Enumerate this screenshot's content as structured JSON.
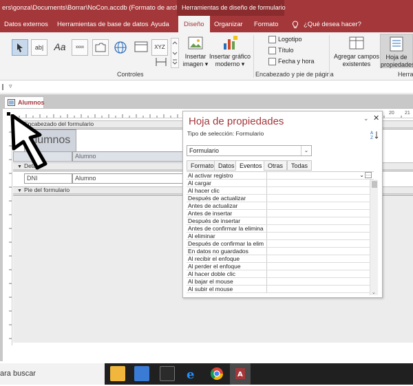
{
  "titlebar": {
    "title": "ers\\gonza\\Documents\\Borrar\\NoCon.accdb (Formato de archi...",
    "context_title": "Herramientas de diseño de formulario"
  },
  "tabs": [
    {
      "label": "Datos externos"
    },
    {
      "label": "Herramientas de base de datos"
    },
    {
      "label": "Ayuda"
    },
    {
      "label": "Diseño"
    },
    {
      "label": "Organizar"
    },
    {
      "label": "Formato"
    },
    {
      "label": "¿Qué desea hacer?"
    }
  ],
  "ribbon": {
    "controls_label": "Controles",
    "controls": [
      "ab|",
      "Aa",
      "xxxx",
      "XYZ"
    ],
    "insert_image": {
      "line1": "Insertar",
      "line2": "imagen ▾"
    },
    "insert_chart": {
      "line1": "Insertar gráfico",
      "line2": "moderno ▾"
    },
    "logo": "Logotipo",
    "title": "Título",
    "datetime": "Fecha y hora",
    "header_footer_label": "Encabezado y pie de página",
    "add_fields": {
      "line1": "Agregar campos",
      "line2": "existentes"
    },
    "property_sheet": {
      "line1": "Hoja de",
      "line2": "propiedades"
    },
    "tools_label": "Herra"
  },
  "document": {
    "tab_label": "Alumnos",
    "header_section": "Encabezado del formulario",
    "header_title": "Alumnos",
    "header_field_label": "Alumno",
    "detail_section": "Detalle",
    "footer_section": "Pie del formulario",
    "fields": [
      {
        "label": "DNI",
        "control": "Alumno"
      }
    ],
    "ruler_marks": [
      "20",
      "21"
    ]
  },
  "property_sheet": {
    "title": "Hoja de propiedades",
    "selection_type": "Tipo de selección:  Formulario",
    "selected_object": "Formulario",
    "tabs": [
      "Formato",
      "Datos",
      "Eventos",
      "Otras",
      "Todas"
    ],
    "active_tab": "Eventos",
    "properties": [
      "Al activar registro",
      "Al cargar",
      "Al hacer clic",
      "Después de actualizar",
      "Antes de actualizar",
      "Antes de insertar",
      "Después de insertar",
      "Antes de confirmar la elimina",
      "Al eliminar",
      "Después de confirmar la elim",
      "En datos no guardados",
      "Al recibir el enfoque",
      "Al perder el enfoque",
      "Al hacer doble clic",
      "Al bajar el mouse",
      "Al subir el mouse"
    ]
  },
  "taskbar": {
    "search": "ara buscar"
  },
  "colors": {
    "brand": "#a4373a",
    "brand_dark": "#8a2b2d",
    "ribbon_bg": "#f3f3f3"
  }
}
